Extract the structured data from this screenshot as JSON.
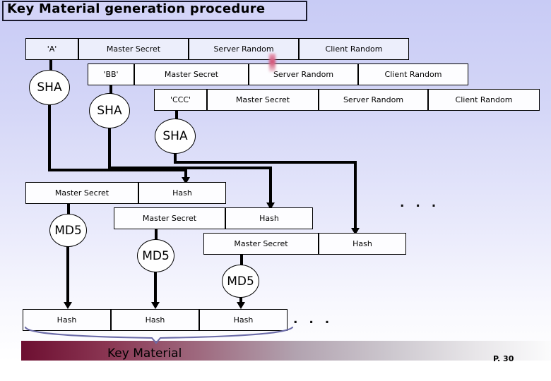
{
  "slide": {
    "title": "Key Material generation procedure",
    "page_label": "P. 30",
    "bottom_label": "Key Material",
    "ellipsis": ". . ."
  },
  "rows": [
    {
      "name": "row-1",
      "cells": [
        {
          "label": "'A'"
        },
        {
          "label": "Master Secret"
        },
        {
          "label": "Server Random"
        },
        {
          "label": "Client Random"
        }
      ]
    },
    {
      "name": "row-2",
      "cells": [
        {
          "label": "'BB'"
        },
        {
          "label": "Master Secret"
        },
        {
          "label": "Server Random"
        },
        {
          "label": "Client Random"
        }
      ]
    },
    {
      "name": "row-3",
      "cells": [
        {
          "label": "'CCC'"
        },
        {
          "label": "Master Secret"
        },
        {
          "label": "Server Random"
        },
        {
          "label": "Client Random"
        }
      ]
    }
  ],
  "sha_nodes": [
    {
      "label": "SHA"
    },
    {
      "label": "SHA"
    },
    {
      "label": "SHA"
    }
  ],
  "mid_rows": [
    {
      "name": "mid-row-1",
      "cells": [
        {
          "label": "Master Secret"
        },
        {
          "label": "Hash"
        }
      ]
    },
    {
      "name": "mid-row-2",
      "cells": [
        {
          "label": "Master Secret"
        },
        {
          "label": "Hash"
        }
      ]
    },
    {
      "name": "mid-row-3",
      "cells": [
        {
          "label": "Master Secret"
        },
        {
          "label": "Hash"
        }
      ]
    }
  ],
  "md5_nodes": [
    {
      "label": "MD5"
    },
    {
      "label": "MD5"
    },
    {
      "label": "MD5"
    }
  ],
  "bottom_row": {
    "name": "hash-output-row",
    "cells": [
      {
        "label": "Hash"
      },
      {
        "label": "Hash"
      },
      {
        "label": "Hash"
      }
    ]
  },
  "colors": {
    "title_fill": "#d3d4f8",
    "background_top": "#c8cbf5",
    "band_start": "#6d0f31",
    "band_end": "#fbfbfc",
    "brace": "#6c6ca8",
    "marker": "#cf4f74"
  }
}
